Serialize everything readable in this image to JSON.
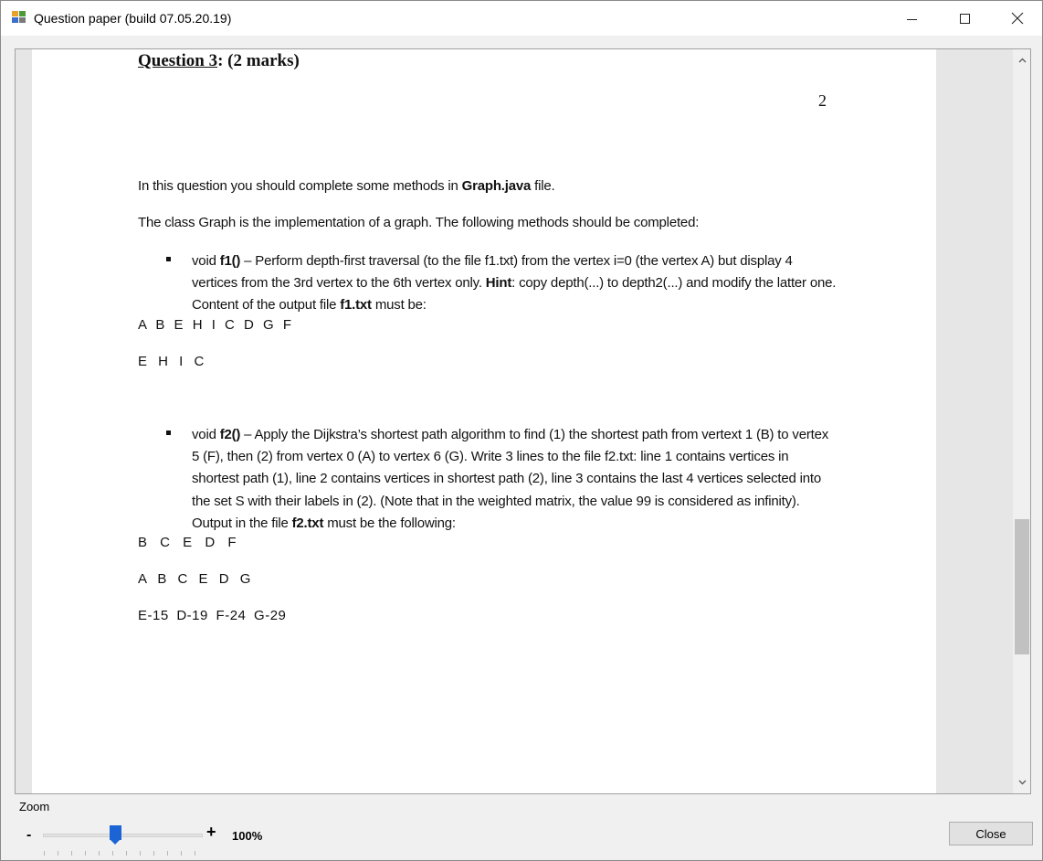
{
  "window": {
    "title": "Question paper (build 07.05.20.19)",
    "controls": {
      "minimize": "minimize",
      "maximize": "maximize",
      "close": "close"
    }
  },
  "document": {
    "heading_prefix": "Question 3",
    "heading_suffix": ": (2 marks)",
    "page_number": "2",
    "intro_line1_pre": "In this question you should complete some methods in ",
    "intro_line1_bold": "Graph.java",
    "intro_line1_post": " file.",
    "intro_line2": "The class Graph is the implementation of a graph. The following methods should be completed:",
    "f1": {
      "sig_pre": "void ",
      "sig_bold": "f1()",
      "text_a": " – Perform depth-first traversal (to the file f1.txt) from the vertex  i=0 (the vertex A) but display 4 vertices from the 3rd vertex to the 6th vertex only. ",
      "hint_label": "Hint",
      "text_b": ": copy depth(...) to depth2(...) and modify the latter one. Content of  the output file ",
      "file_bold": "f1.txt",
      "text_c": " must be:",
      "output_line1": "A B E H I C D G F",
      "output_line2": "E H I C"
    },
    "f2": {
      "sig_pre": "void ",
      "sig_bold": "f2()",
      "text_a": " – Apply the Dijkstra’s shortest path algorithm to find (1) the shortest path from vertext 1 (B) to vertex 5 (F), then (2) from vertex 0 (A) to vertex 6 (G). Write 3 lines to the file f2.txt: line 1 contains  vertices in shortest path (1), line 2 contains  vertices in shortest path (2), line 3 contains the last 4 vertices selected into the set  S with their labels in (2). (Note that in the weighted matrix, the value 99 is considered as infinity). Output in the file ",
      "file_bold": "f2.txt",
      "text_b": " must be the following:",
      "output_line1": "B C E D F",
      "output_line2": "A B C E D G",
      "output_line3": "E-15  D-19  F-24  G-29"
    }
  },
  "scrollbar": {
    "up_icon": "chevron-up",
    "down_icon": "chevron-down"
  },
  "zoom": {
    "label": "Zoom",
    "minus": "-",
    "plus": "+",
    "value": "100%",
    "level_fraction": 0.45
  },
  "close_button": "Close"
}
